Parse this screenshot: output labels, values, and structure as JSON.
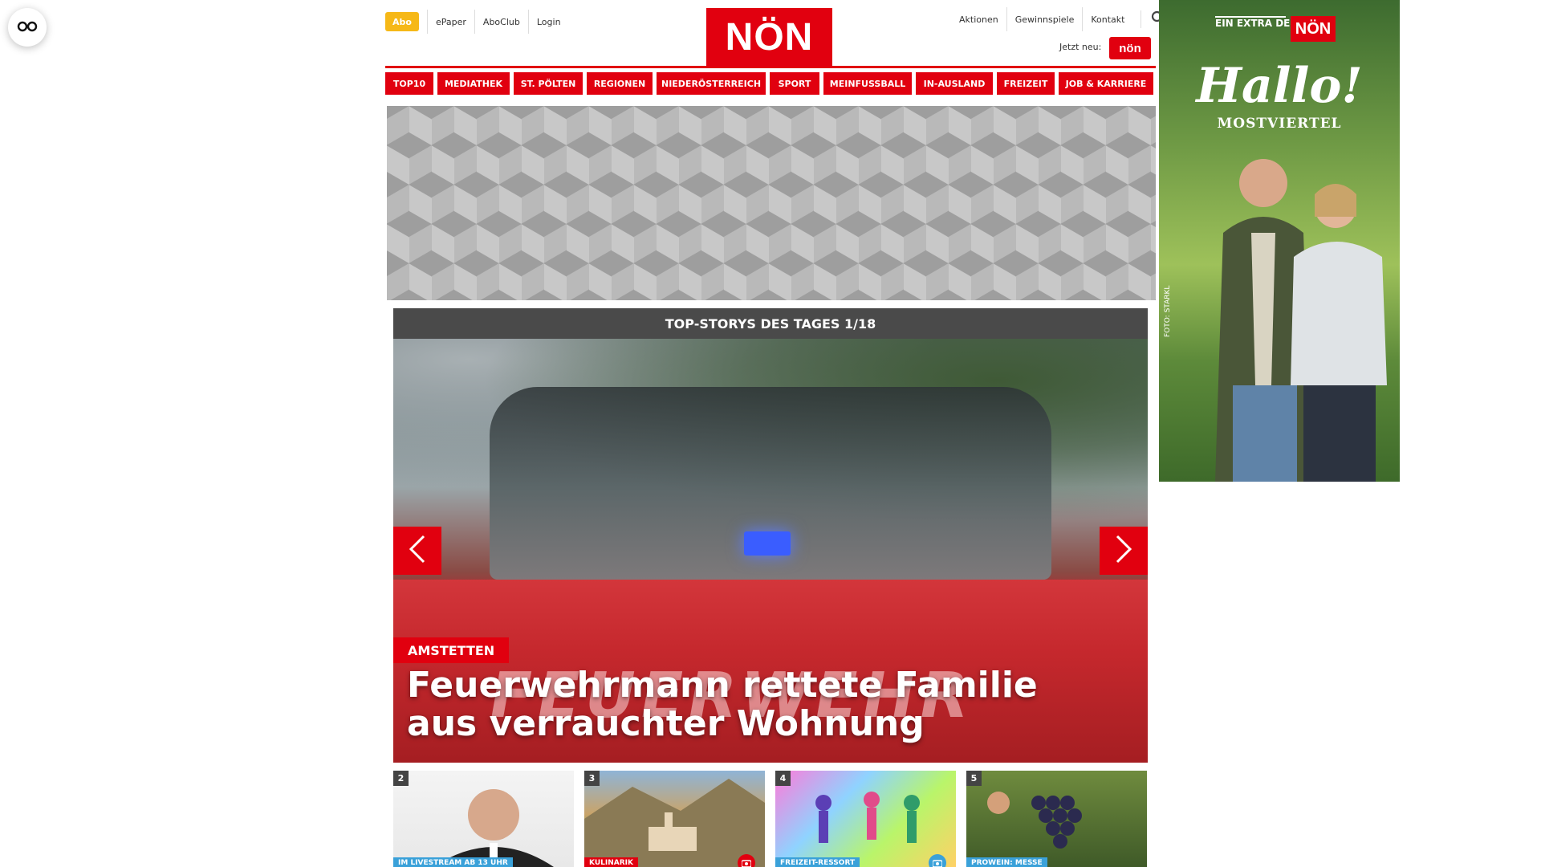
{
  "header": {
    "abo_label": "Abo",
    "left_links": [
      "ePaper",
      "AboClub",
      "Login"
    ],
    "right_links": [
      "Aktionen",
      "Gewinnspiele",
      "Kontakt"
    ],
    "logo_text": "NÖN",
    "jetzt_label": "Jetzt neu:",
    "mini_logo_text": "nön"
  },
  "nav": {
    "items": [
      "TOP10",
      "MEDIATHEK",
      "ST. PÖLTEN",
      "REGIONEN",
      "NIEDERÖSTERREICH",
      "SPORT",
      "MEINFUSSBALL",
      "IN-AUSLAND",
      "FREIZEIT",
      "JOB & KARRIERE"
    ]
  },
  "sidead": {
    "extra_label": "EIN EXTRA DER",
    "brand": "NÖN",
    "headline": "Hallo!",
    "subheadline": "MOSTVIERTEL",
    "credit": "FOTO: STARKL"
  },
  "topstories": {
    "header": "TOP-STORYS DES TAGES 1/18",
    "hero": {
      "category": "AMSTETTEN",
      "title": "Feuerwehrmann rettete Familie aus verrauchter Wohnung",
      "image_text": "FEUERWEHR"
    },
    "thumbs": [
      {
        "number": "2",
        "tag": "IM LIVESTREAM AB 13 UHR",
        "tag_color": "#3aa1d9"
      },
      {
        "number": "3",
        "tag": "KULINARIK",
        "tag_color": "#e1000f"
      },
      {
        "number": "4",
        "tag": "FREIZEIT-RESSORT",
        "tag_color": "#3aa1d9"
      },
      {
        "number": "5",
        "tag": "PROWEIN: MESSE",
        "tag_color": "#3aa1d9"
      }
    ]
  },
  "colors": {
    "brand_red": "#e1000f",
    "abo_yellow": "#f6b817",
    "dark_gray": "#4a4a4a"
  },
  "icons": [
    "glasses-icon",
    "search-icon",
    "chevron-left-icon",
    "chevron-right-icon",
    "camera-icon"
  ]
}
